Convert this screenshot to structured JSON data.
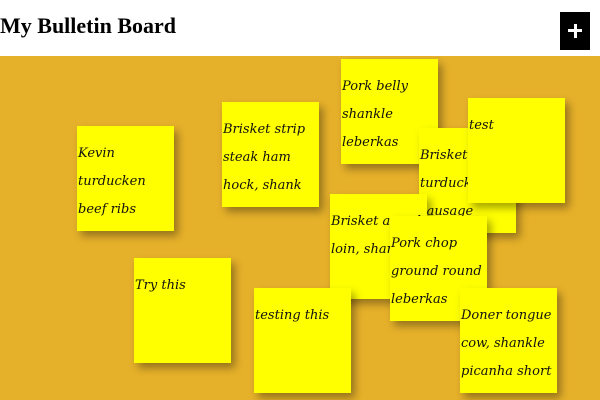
{
  "header": {
    "title": "My Bulletin Board",
    "add_button_icon": "plus-icon"
  },
  "notes": [
    {
      "text": "Kevin turducken beef ribs pastrami"
    },
    {
      "text": "Brisket strip steak ham hock, shank ribeye biltong capicola"
    },
    {
      "text": "Pork belly shankle leberkas ground round"
    },
    {
      "text": "Brisket turducken sausage capicola"
    },
    {
      "text": "test"
    },
    {
      "text": "Brisket a pork loin, shankle"
    },
    {
      "text": "Pork chop ground round leberkas"
    },
    {
      "text": "Try this"
    },
    {
      "text": "testing this"
    },
    {
      "text": "Doner tongue cow, shankle picanha short"
    }
  ],
  "colors": {
    "board": "#e6b12a",
    "note": "#ffff00",
    "button": "#000000"
  }
}
